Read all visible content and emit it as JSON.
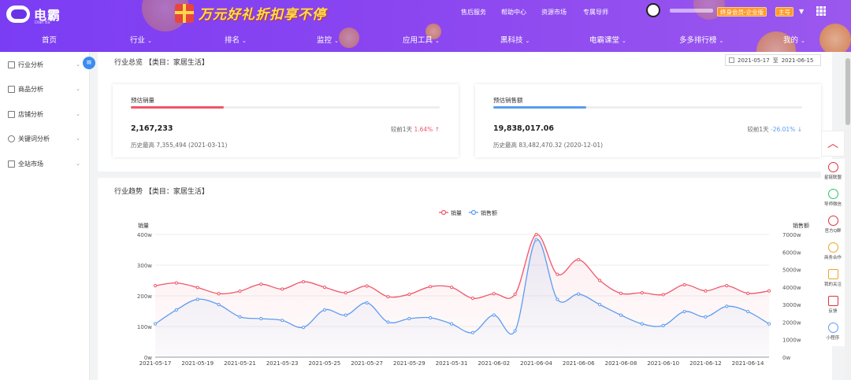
{
  "header": {
    "logo": "电霸",
    "logo_sub": "Dian Ba",
    "banner": "万元好礼折扣享不停",
    "top_links": [
      "售后服务",
      "帮助中心",
      "资源市场",
      "专属导师"
    ],
    "member_badge": "终身会员-企业版",
    "account_badge": "主号",
    "nav": [
      {
        "label": "首页",
        "dropdown": false
      },
      {
        "label": "行业",
        "dropdown": true
      },
      {
        "label": "排名",
        "dropdown": true
      },
      {
        "label": "监控",
        "dropdown": true
      },
      {
        "label": "应用工具",
        "dropdown": true
      },
      {
        "label": "黑科技",
        "dropdown": true
      },
      {
        "label": "电霸课堂",
        "dropdown": true
      },
      {
        "label": "多多排行榜",
        "dropdown": true
      },
      {
        "label": "我的",
        "dropdown": true
      }
    ]
  },
  "sidebar": {
    "items": [
      {
        "label": "行业分析"
      },
      {
        "label": "商品分析"
      },
      {
        "label": "店铺分析"
      },
      {
        "label": "关键词分析"
      },
      {
        "label": "全站市场"
      }
    ],
    "collapse_icon": "menu-icon"
  },
  "overview": {
    "title": "行业总览 【类目：家居生活】",
    "date_from": "2021-05-17",
    "date_sep": "至",
    "date_to": "2021-06-15",
    "cards": [
      {
        "label": "预估销量",
        "value": "2,167,233",
        "compare_label": "较前1天",
        "compare_value": "1.64%",
        "trend": "↑",
        "history": "历史最高 7,355,494 (2021-03-11)",
        "color": "#f0566a",
        "fill": 0.3
      },
      {
        "label": "预估销售额",
        "value": "19,838,017.06",
        "compare_label": "较前1天",
        "compare_value": "-26.01%",
        "trend": "↓",
        "history": "历史最高 83,482,470.32 (2020-12-01)",
        "color": "#5b9cf0",
        "fill": 0.3
      }
    ]
  },
  "trend": {
    "title": "行业趋势 【类目：家居生活】"
  },
  "chart_data": {
    "type": "line",
    "legend": [
      "销量",
      "销售额"
    ],
    "legend_position": "top-center",
    "ylabel_left": "销量",
    "ylabel_right": "销售额",
    "y_left_ticks": [
      "0w",
      "100w",
      "200w",
      "300w",
      "400w"
    ],
    "y_left_range": [
      0,
      400
    ],
    "y_right_ticks": [
      "0w",
      "1000w",
      "2000w",
      "3000w",
      "4000w",
      "5000w",
      "6000w",
      "7000w"
    ],
    "y_right_range": [
      0,
      7000
    ],
    "x_tick_labels": [
      "2021-05-17",
      "2021-05-19",
      "2021-05-21",
      "2021-05-23",
      "2021-05-25",
      "2021-05-27",
      "2021-05-29",
      "2021-05-31",
      "2021-06-02",
      "2021-06-04",
      "2021-06-06",
      "2021-06-08",
      "2021-06-10",
      "2021-06-12",
      "2021-06-14"
    ],
    "x": [
      "2021-05-17",
      "2021-05-18",
      "2021-05-19",
      "2021-05-20",
      "2021-05-21",
      "2021-05-22",
      "2021-05-23",
      "2021-05-24",
      "2021-05-25",
      "2021-05-26",
      "2021-05-27",
      "2021-05-28",
      "2021-05-29",
      "2021-05-30",
      "2021-05-31",
      "2021-06-01",
      "2021-06-02",
      "2021-06-03",
      "2021-06-04",
      "2021-06-05",
      "2021-06-06",
      "2021-06-07",
      "2021-06-08",
      "2021-06-09",
      "2021-06-10",
      "2021-06-11",
      "2021-06-12",
      "2021-06-13",
      "2021-06-14",
      "2021-06-15"
    ],
    "series": [
      {
        "name": "销量",
        "axis": "left",
        "color": "#f0566a",
        "values": [
          233,
          242,
          227,
          207,
          215,
          238,
          222,
          246,
          228,
          210,
          232,
          197,
          205,
          230,
          228,
          192,
          207,
          205,
          400,
          270,
          318,
          250,
          208,
          210,
          204,
          236,
          216,
          233,
          208,
          216
        ]
      },
      {
        "name": "销售额",
        "axis": "right",
        "color": "#5b9cf0",
        "values": [
          1900,
          2700,
          3300,
          3000,
          2300,
          2200,
          2100,
          1700,
          2700,
          2400,
          3100,
          2000,
          2200,
          2250,
          1900,
          1400,
          2400,
          1500,
          6700,
          3300,
          3600,
          3000,
          2400,
          1900,
          1800,
          2600,
          2300,
          2900,
          2600,
          1900
        ]
      }
    ],
    "grid": true
  },
  "right_toolbar": {
    "up_icon": "chevron-up-icon",
    "items": [
      {
        "label": "星链联盟",
        "icon": "play-icon"
      },
      {
        "label": "导师微信",
        "icon": "wechat-icon"
      },
      {
        "label": "官方Q群",
        "icon": "qq-icon"
      },
      {
        "label": "商务合作",
        "icon": "handshake-icon"
      },
      {
        "label": "我的关注",
        "icon": "star-icon"
      },
      {
        "label": "反馈",
        "icon": "edit-icon"
      },
      {
        "label": "小程序",
        "icon": "mini-program-icon"
      }
    ]
  }
}
